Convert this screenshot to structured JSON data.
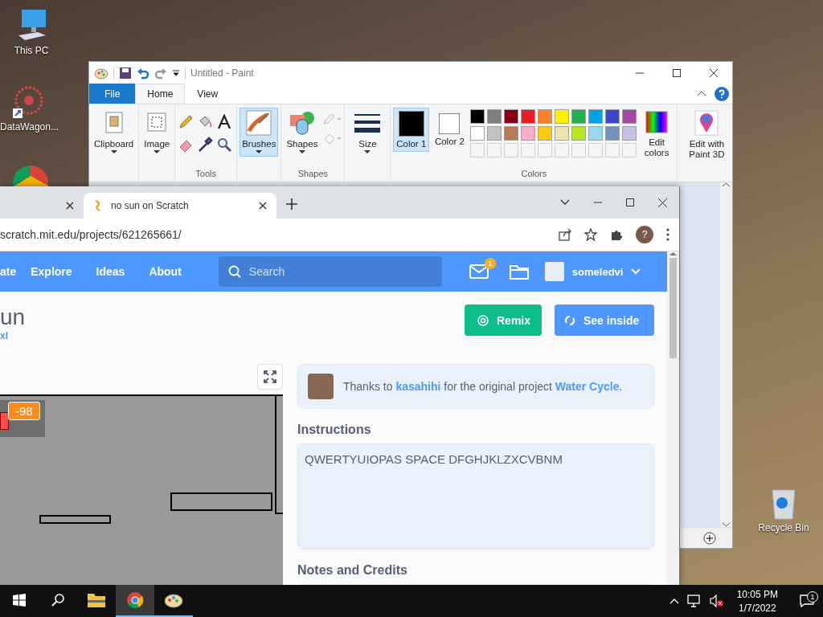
{
  "desktop": {
    "icons": [
      {
        "label": "This PC",
        "kind": "pc"
      },
      {
        "label": "DataWagon...",
        "kind": "datawagon"
      },
      {
        "label": "Recycle Bin",
        "kind": "bin"
      }
    ]
  },
  "paint": {
    "title": "Untitled - Paint",
    "tabs": [
      {
        "label": "File",
        "kind": "file",
        "selected": false
      },
      {
        "label": "Home",
        "kind": "tab",
        "selected": true
      },
      {
        "label": "View",
        "kind": "tab",
        "selected": false
      }
    ],
    "clipboard": "Clipboard",
    "image": "Image",
    "tools": "Tools",
    "brushes": {
      "label": "Brushes",
      "selected": true
    },
    "shapes": "Shapes",
    "shapes_group": "Shapes",
    "size": "Size",
    "color_slots": [
      {
        "label": "Color 1",
        "color": "#000000",
        "selected": true
      },
      {
        "label": "Color 2",
        "color": "#ffffff",
        "selected": false
      }
    ],
    "swatches": [
      {
        "kind": "color",
        "color": "#000000"
      },
      {
        "kind": "color",
        "color": "#7f7f7f"
      },
      {
        "kind": "color",
        "color": "#880015"
      },
      {
        "kind": "color",
        "color": "#ed1c24"
      },
      {
        "kind": "color",
        "color": "#ff7f27"
      },
      {
        "kind": "color",
        "color": "#fff200"
      },
      {
        "kind": "color",
        "color": "#22b14c"
      },
      {
        "kind": "color",
        "color": "#00a2e8"
      },
      {
        "kind": "color",
        "color": "#3f48cc"
      },
      {
        "kind": "color",
        "color": "#a349a4"
      },
      {
        "kind": "color",
        "color": "#ffffff"
      },
      {
        "kind": "color",
        "color": "#c3c3c3"
      },
      {
        "kind": "color",
        "color": "#b97a57"
      },
      {
        "kind": "color",
        "color": "#ffaec9"
      },
      {
        "kind": "color",
        "color": "#ffc90e"
      },
      {
        "kind": "color",
        "color": "#efe4b0"
      },
      {
        "kind": "color",
        "color": "#b5e61d"
      },
      {
        "kind": "color",
        "color": "#99d9ea"
      },
      {
        "kind": "color",
        "color": "#7092be"
      },
      {
        "kind": "color",
        "color": "#c8bfe7"
      },
      {
        "kind": "empty"
      },
      {
        "kind": "empty"
      },
      {
        "kind": "empty"
      },
      {
        "kind": "empty"
      },
      {
        "kind": "empty"
      },
      {
        "kind": "empty"
      },
      {
        "kind": "empty"
      },
      {
        "kind": "empty"
      },
      {
        "kind": "empty"
      },
      {
        "kind": "empty"
      }
    ],
    "edit_colors": "Edit colors",
    "colors_group": "Colors",
    "paint3d": "Edit with Paint 3D"
  },
  "browser": {
    "tabs": [
      {
        "selected": false
      },
      {
        "title": "no sun on Scratch",
        "selected": true
      }
    ],
    "url": "scratch.mit.edu/projects/621265661/",
    "profile_initial": "?"
  },
  "scratch": {
    "nav": [
      {
        "label": "ate"
      },
      {
        "label": "Explore"
      },
      {
        "label": "Ideas"
      },
      {
        "label": "About"
      }
    ],
    "search_placeholder": "Search",
    "messages_badge": "1",
    "username": "someledvi",
    "project_title": "un",
    "author": "xl",
    "buttons": [
      {
        "label": "Remix",
        "kind": "remix"
      },
      {
        "label": "See inside",
        "kind": "inside"
      }
    ],
    "monitor_value": "-98",
    "credit": {
      "before": "Thanks to",
      "user": "kasahihi",
      "middle": "for the original project",
      "project": "Water Cycle",
      "after": "."
    },
    "instructions_heading": "Instructions",
    "instructions": "QWERTYUIOPAS SPACE DFGHJKLZXCVBNM",
    "notes_heading": "Notes and Credits"
  },
  "taskbar": {
    "apps": [
      {
        "kind": "explorer",
        "active": false
      },
      {
        "kind": "chrome",
        "active": true
      },
      {
        "kind": "paint",
        "active": true
      }
    ],
    "time": "10:05 PM",
    "date": "1/7/2022",
    "notification_count": "1"
  }
}
